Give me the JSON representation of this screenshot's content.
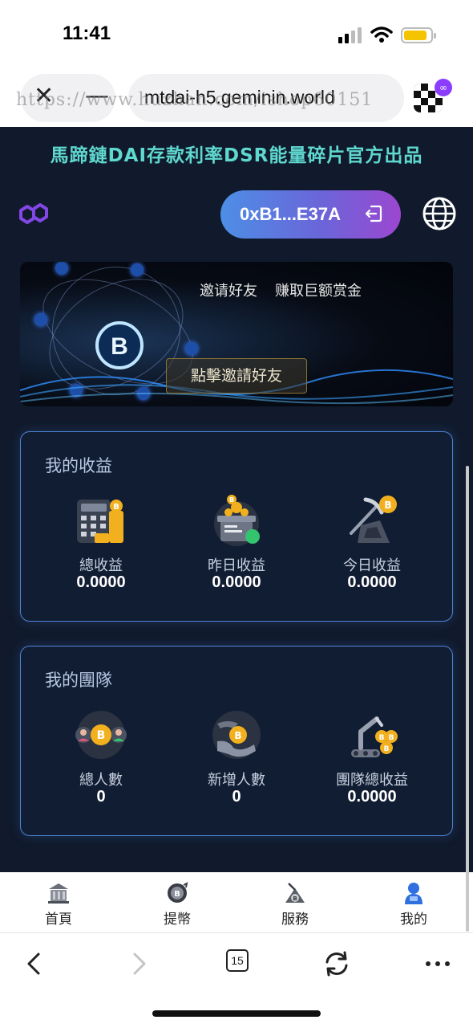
{
  "status_bar": {
    "time": "11:41"
  },
  "browser": {
    "url": "mtdai-h5.geminin.world",
    "watermark": "https://www.huzhan.com/ishop60151",
    "tab_count": "15"
  },
  "app": {
    "marquee": "馬蹄鏈DAI存款利率DSR能量碎片官方出品",
    "wallet_address": "0xB1...E37A",
    "banner": {
      "headline_left": "邀请好友",
      "headline_right": "赚取巨额赏金",
      "button": "點擊邀請好友"
    },
    "earnings": {
      "title": "我的收益",
      "items": [
        {
          "label": "總收益",
          "value": "0.0000",
          "icon": "calculator-coins-icon"
        },
        {
          "label": "昨日收益",
          "value": "0.0000",
          "icon": "coin-box-icon"
        },
        {
          "label": "今日收益",
          "value": "0.0000",
          "icon": "mining-pickaxe-icon"
        }
      ]
    },
    "team": {
      "title": "我的團隊",
      "items": [
        {
          "label": "總人數",
          "value": "0",
          "icon": "people-coin-icon"
        },
        {
          "label": "新增人數",
          "value": "0",
          "icon": "hand-coin-icon"
        },
        {
          "label": "團隊總收益",
          "value": "0.0000",
          "icon": "robot-arm-coins-icon"
        }
      ]
    }
  },
  "tabbar": {
    "items": [
      {
        "label": "首頁",
        "icon": "bank-icon"
      },
      {
        "label": "提幣",
        "icon": "coin-withdraw-icon"
      },
      {
        "label": "服務",
        "icon": "service-icon"
      },
      {
        "label": "我的",
        "icon": "user-icon"
      }
    ]
  },
  "colors": {
    "app_bg": "#101a2c",
    "marquee": "#5fd8cf",
    "card_border": "#4e84d4",
    "coin_gold": "#f2b01e",
    "address_gradient_start": "#4d8ee6",
    "address_gradient_end": "#9b47d0"
  }
}
